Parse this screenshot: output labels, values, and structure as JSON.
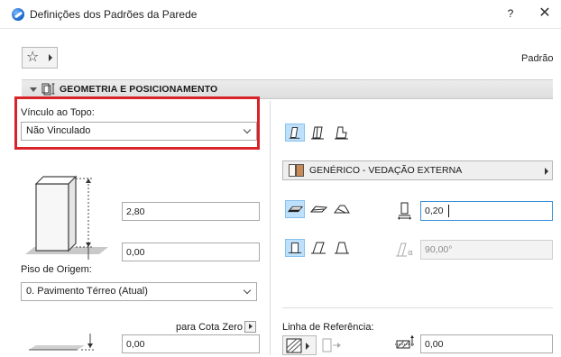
{
  "window": {
    "title": "Definições dos Padrões da Parede",
    "help_label": "?",
    "close_label": "✕"
  },
  "toolbar": {
    "favorites_icon": "star-icon",
    "default_label": "Padrão"
  },
  "section": {
    "title": "GEOMETRIA E POSICIONAMENTO"
  },
  "top_link": {
    "label": "Vínculo ao Topo:",
    "value": "Não Vinculado"
  },
  "wall": {
    "height": "2,80",
    "base_offset": "0,00"
  },
  "home_floor": {
    "label": "Piso de Origem:",
    "value": "0. Pavimento Térreo (Atual)"
  },
  "zero": {
    "label": "para Cota Zero",
    "value": "0,00"
  },
  "structure": {
    "material": "GENÉRICO - VEDAÇÃO EXTERNA",
    "thickness": "0,20",
    "angle": "90,00°"
  },
  "reference_line": {
    "label": "Linha de Referência:",
    "offset": "0,00"
  },
  "colors": {
    "highlight": "#d9232a",
    "selected_tool": "#bfe0fb",
    "focus_border": "#3c8fd8"
  }
}
